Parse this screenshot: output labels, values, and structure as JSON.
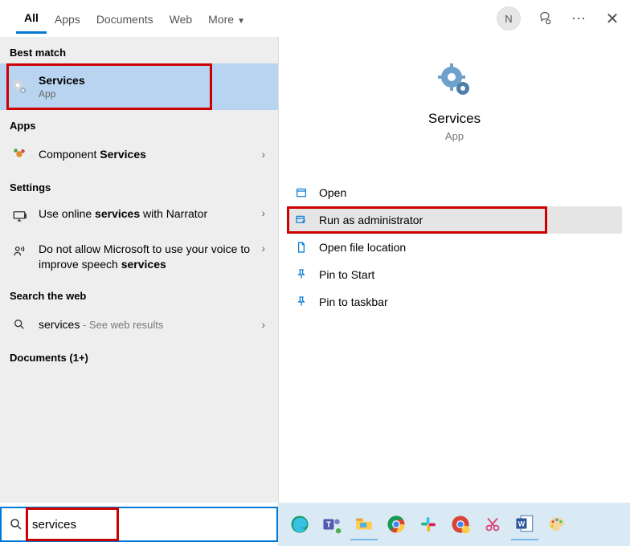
{
  "tabs": {
    "all": "All",
    "apps": "Apps",
    "documents": "Documents",
    "web": "Web",
    "more": "More"
  },
  "avatar_letter": "N",
  "left": {
    "best_match_label": "Best match",
    "best": {
      "title": "Services",
      "sub": "App"
    },
    "apps_label": "Apps",
    "component_pre": "Component ",
    "component_hl": "Services",
    "settings_label": "Settings",
    "setting1_pre": "Use online ",
    "setting1_hl": "services",
    "setting1_post": " with Narrator",
    "setting2_pre": "Do not allow Microsoft to use your voice to improve speech ",
    "setting2_hl": "services",
    "searchweb_label": "Search the web",
    "web_term": "services",
    "web_sub": " - See web results",
    "documents_label": "Documents (1+)"
  },
  "preview": {
    "title": "Services",
    "sub": "App",
    "actions": {
      "open": "Open",
      "run_admin": "Run as administrator",
      "open_loc": "Open file location",
      "pin_start": "Pin to Start",
      "pin_taskbar": "Pin to taskbar"
    }
  },
  "search": {
    "value": "services"
  }
}
